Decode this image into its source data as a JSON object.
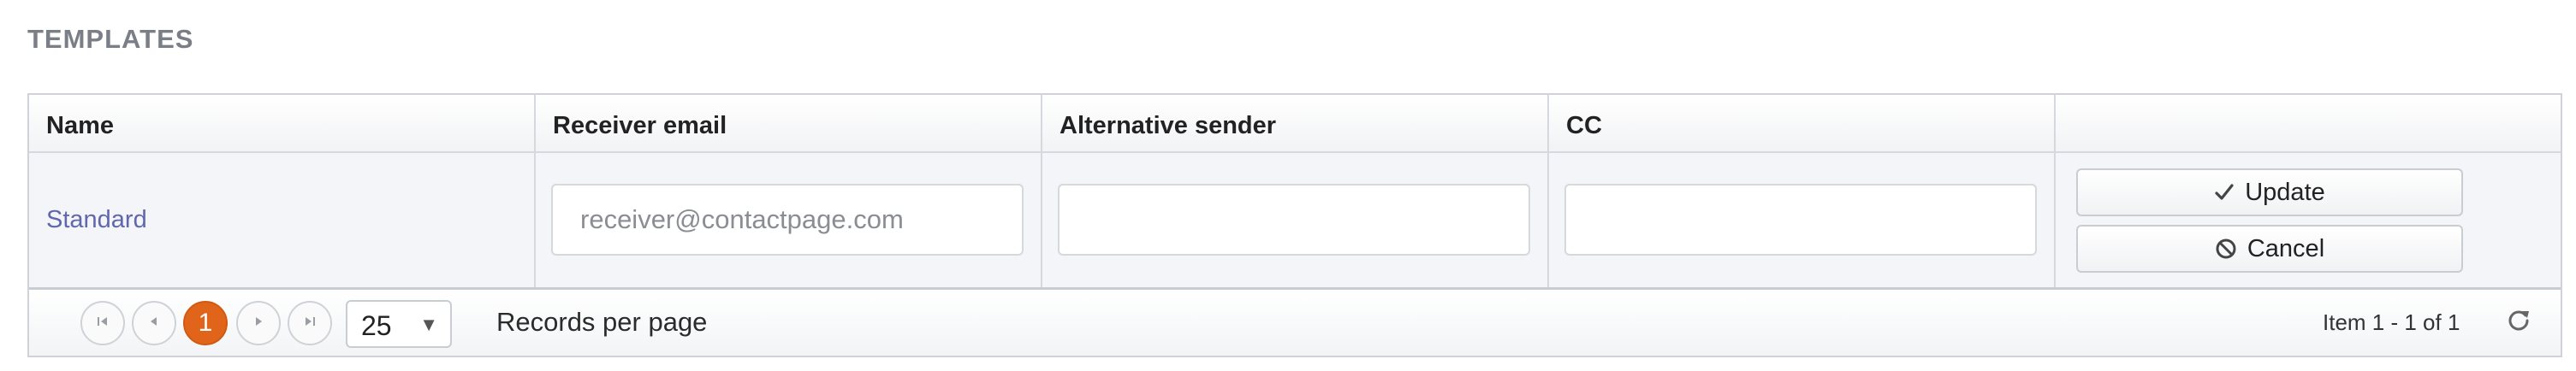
{
  "section": {
    "title": "TEMPLATES"
  },
  "table": {
    "columns": [
      "Name",
      "Receiver email",
      "Alternative sender",
      "CC",
      ""
    ],
    "rows": [
      {
        "name": "Standard",
        "receiver_email": {
          "value": "",
          "placeholder": "receiver@contactpage.com"
        },
        "alternative_sender": {
          "value": "",
          "placeholder": ""
        },
        "cc": {
          "value": "",
          "placeholder": ""
        }
      }
    ],
    "actions": {
      "update_label": "Update",
      "cancel_label": "Cancel"
    }
  },
  "pager": {
    "current_page": "1",
    "page_size": "25",
    "records_per_page_label": "Records per page",
    "item_info": "Item 1 - 1 of 1"
  },
  "colors": {
    "accent": "#e0651a",
    "link": "#6067ad",
    "header_text": "#7a7f87"
  },
  "icons": {
    "first_page": "first-page-icon",
    "prev_page": "previous-page-icon",
    "next_page": "next-page-icon",
    "last_page": "last-page-icon",
    "update": "checkmark-icon",
    "cancel": "cancel-icon",
    "refresh": "refresh-icon",
    "dropdown": "chevron-down-icon"
  }
}
